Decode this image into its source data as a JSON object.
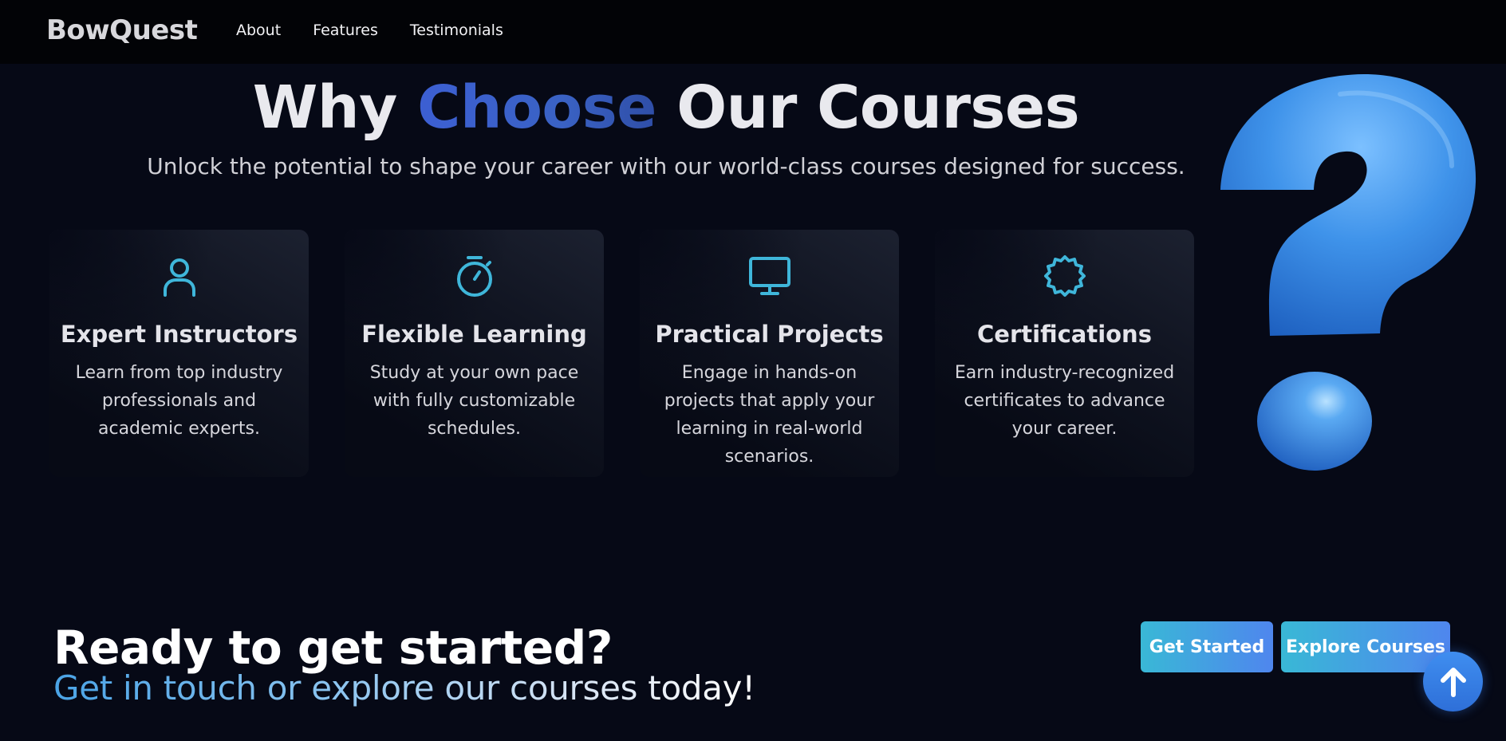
{
  "nav": {
    "brand": "BowQuest",
    "links": [
      "About",
      "Features",
      "Testimonials"
    ]
  },
  "hero": {
    "title_part1": "Why",
    "title_accent": "Choose",
    "title_part2": "Our Courses",
    "subtitle": "Unlock the potential to shape your career with our world-class courses designed for success."
  },
  "features": [
    {
      "icon": "user-icon",
      "title": "Expert Instructors",
      "text": "Learn from top industry professionals and academic experts."
    },
    {
      "icon": "stopwatch-icon",
      "title": "Flexible Learning",
      "text": "Study at your own pace with fully customizable schedules."
    },
    {
      "icon": "monitor-icon",
      "title": "Practical Projects",
      "text": "Engage in hands-on projects that apply your learning in real-world scenarios."
    },
    {
      "icon": "badge-icon",
      "title": "Certifications",
      "text": "Earn industry-recognized certificates to advance your career."
    }
  ],
  "cta": {
    "title": "Ready to get started?",
    "subtitle": "Get in touch or explore our courses today!",
    "primary_button": "Get Started",
    "secondary_button": "Explore Courses"
  },
  "decor": {
    "question_mark_icon": "question-mark-3d-icon",
    "scroll_top_icon": "arrow-up-icon"
  },
  "colors": {
    "background": "#060916",
    "nav_background": "#020306",
    "accent_blue": "#3c5fd3",
    "icon_cyan": "#3fb6da",
    "button_gradient_start": "#39b8d6",
    "button_gradient_end": "#4f86ee"
  }
}
